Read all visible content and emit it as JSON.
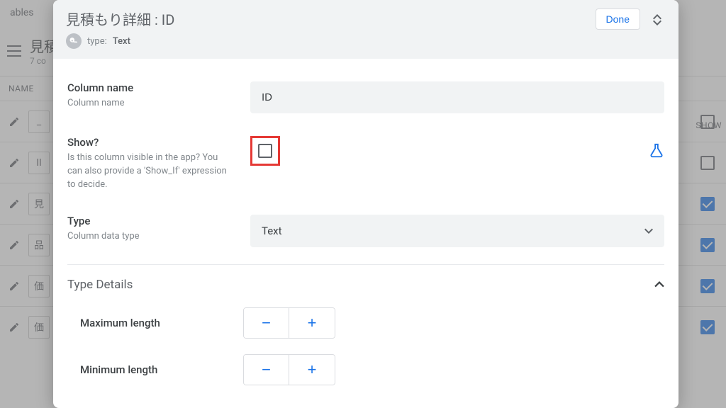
{
  "background": {
    "tables_label": "ables",
    "table_name": "見積",
    "columns_summary": "7 co",
    "columns_header_name": "NAME",
    "columns_header_show": "SHOW",
    "rows": [
      {
        "glyph": "_",
        "show_checked": false
      },
      {
        "glyph": "II",
        "show_checked": false
      },
      {
        "glyph": "見",
        "show_checked": true
      },
      {
        "glyph": "品",
        "show_checked": true
      },
      {
        "glyph": "価",
        "show_checked": true
      },
      {
        "glyph": "価",
        "show_checked": true
      }
    ]
  },
  "modal": {
    "title": "見積もり詳細 : ID",
    "type_label": "type:",
    "type_value": "Text",
    "done_label": "Done",
    "fields": {
      "column_name": {
        "label": "Column name",
        "desc": "Column name",
        "value": "ID"
      },
      "show": {
        "label": "Show?",
        "desc": "Is this column visible in the app? You can also provide a 'Show_If' expression to decide.",
        "checked": false
      },
      "type": {
        "label": "Type",
        "desc": "Column data type",
        "value": "Text"
      }
    },
    "type_details": {
      "header": "Type Details",
      "max_length_label": "Maximum length",
      "min_length_label": "Minimum length"
    }
  }
}
